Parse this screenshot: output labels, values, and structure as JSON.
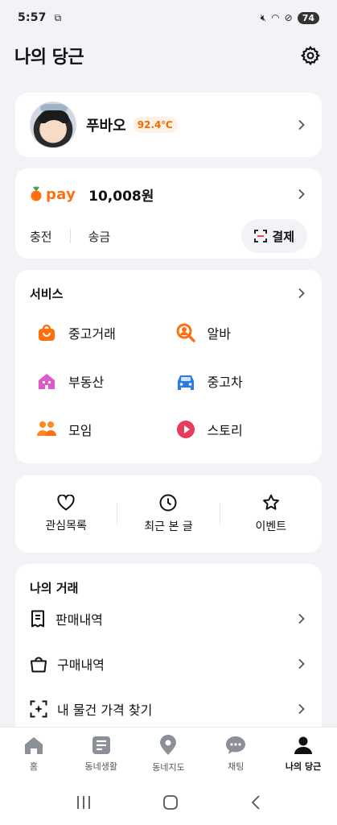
{
  "status_bar": {
    "time": "5:57",
    "battery": "74"
  },
  "header": {
    "title": "나의 당근"
  },
  "profile": {
    "name": "푸바오",
    "temperature": "92.4℃"
  },
  "pay": {
    "logo": "pay",
    "balance": "10,008원",
    "charge_label": "충전",
    "transfer_label": "송금",
    "payment_label": "결제"
  },
  "services": {
    "title": "서비스",
    "items": [
      {
        "label": "중고거래",
        "icon": "shopping-bag-icon"
      },
      {
        "label": "알바",
        "icon": "search-person-icon"
      },
      {
        "label": "부동산",
        "icon": "house-icon"
      },
      {
        "label": "중고차",
        "icon": "car-icon"
      },
      {
        "label": "모임",
        "icon": "group-icon"
      },
      {
        "label": "스토리",
        "icon": "play-icon"
      }
    ]
  },
  "shortcuts": {
    "favorites": "관심목록",
    "recent": "최근 본 글",
    "events": "이벤트"
  },
  "trades": {
    "title": "나의 거래",
    "items": [
      {
        "label": "판매내역",
        "icon": "receipt-icon"
      },
      {
        "label": "구매내역",
        "icon": "bag-icon"
      },
      {
        "label": "내 물건 가격 찾기",
        "icon": "scan-icon"
      }
    ]
  },
  "nav": {
    "home": "홈",
    "community": "동네생활",
    "map": "동네지도",
    "chat": "채팅",
    "my": "나의 당근"
  },
  "colors": {
    "brand": "#ff6f0f",
    "background": "#f2f3f6"
  }
}
